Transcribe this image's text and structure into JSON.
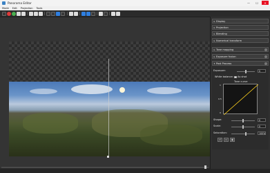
{
  "window": {
    "title": "Panorama Editor",
    "minimize": "—",
    "maximize": "☐",
    "close": "✕"
  },
  "menu": [
    "Mode",
    "Edit",
    "Projection",
    "Tools"
  ],
  "sidebar": {
    "sections": [
      {
        "label": "Display"
      },
      {
        "label": "Projection"
      },
      {
        "label": "Blending"
      },
      {
        "label": "Numerical transform"
      },
      {
        "label": "Tone mapping"
      },
      {
        "label": "Exposure fusion"
      },
      {
        "label": "Post Process"
      }
    ],
    "post_process": {
      "exposure_label": "Exposure:",
      "exposure_value": "0",
      "white_balance_label": "White balance:",
      "as_shot_label": "As shot",
      "tone_curve_title": "Tone curve",
      "curve_y_max": "1",
      "curve_y_mid": "0.5",
      "curve_y_min": "0",
      "shape_label": "Shape:",
      "shape_value": "0",
      "scale_label": "Scale:",
      "scale_value": "0",
      "saturation_label": "Saturation:",
      "saturation_value": "100%"
    }
  },
  "colors": {
    "accent": "#2f7fe0",
    "close": "#e81123"
  }
}
